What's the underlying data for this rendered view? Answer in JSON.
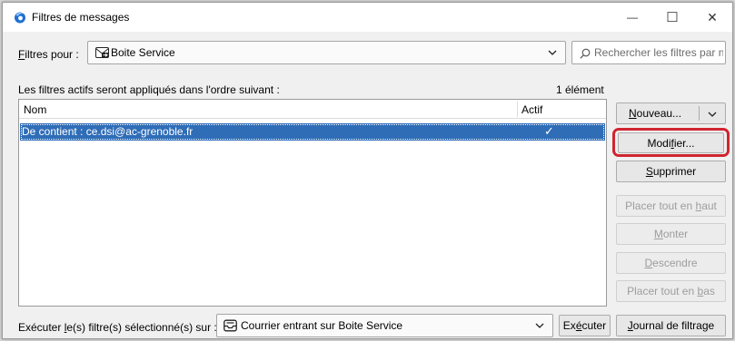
{
  "window": {
    "title": "Filtres de messages",
    "minimize_glyph": "—",
    "maximize_glyph": "☐",
    "close_glyph": "✕"
  },
  "filters_for": {
    "label_pre": "",
    "label_u": "F",
    "label_post": "iltres pour :",
    "account": "Boite Service",
    "account_icon": "mailbox-icon"
  },
  "search": {
    "placeholder": "Rechercher les filtres par n"
  },
  "list_header": {
    "info": "Les filtres actifs seront appliqués dans l'ordre suivant :",
    "count": "1 élément"
  },
  "columns": {
    "name": "Nom",
    "active": "Actif"
  },
  "rows": [
    {
      "name": "De contient : ce.dsi@ac-grenoble.fr",
      "active_mark": "✓",
      "selected": true
    }
  ],
  "buttons": {
    "new": {
      "pre": "",
      "u": "N",
      "post": "ouveau..."
    },
    "edit": {
      "pre": "Modi",
      "u": "f",
      "post": "ier..."
    },
    "delete": {
      "pre": "",
      "u": "S",
      "post": "upprimer"
    },
    "to_top": {
      "pre": "Placer tout en ",
      "u": "h",
      "post": "aut"
    },
    "up": {
      "pre": "",
      "u": "M",
      "post": "onter"
    },
    "down": {
      "pre": "",
      "u": "D",
      "post": "escendre"
    },
    "to_bottom": {
      "pre": "Placer tout en ",
      "u": "b",
      "post": "as"
    },
    "run": {
      "pre": "Ex",
      "u": "é",
      "post": "cuter"
    },
    "log": {
      "pre": "",
      "u": "J",
      "post": "ournal de filtrage"
    }
  },
  "run_on": {
    "label_pre": "Exécuter ",
    "label_u": "l",
    "label_post": "e(s) filtre(s) sélectionné(s) sur :",
    "folder": "Courrier entrant sur Boite Service",
    "folder_icon": "inbox-icon"
  },
  "colors": {
    "selection": "#2f6db7",
    "highlight": "#d0252f",
    "app_icon": "#1f6fd1"
  }
}
